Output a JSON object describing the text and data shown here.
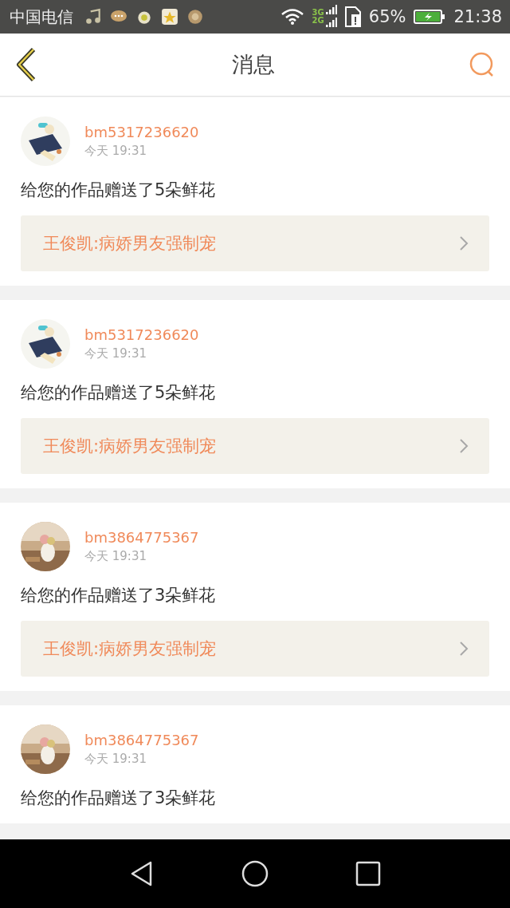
{
  "status_bar": {
    "carrier": "中国电信",
    "network_labels": [
      "3G",
      "2G"
    ],
    "battery_percent": "65%",
    "time": "21:38"
  },
  "header": {
    "title": "消息"
  },
  "messages": [
    {
      "username": "bm5317236620",
      "time": "今天 19:31",
      "text": "给您的作品赠送了5朵鲜花",
      "work_title": "王俊凯:病娇男友强制宠"
    },
    {
      "username": "bm5317236620",
      "time": "今天 19:31",
      "text": "给您的作品赠送了5朵鲜花",
      "work_title": "王俊凯:病娇男友强制宠"
    },
    {
      "username": "bm3864775367",
      "time": "今天 19:31",
      "text": "给您的作品赠送了3朵鲜花",
      "work_title": "王俊凯:病娇男友强制宠"
    },
    {
      "username": "bm3864775367",
      "time": "今天 19:31",
      "text": "给您的作品赠送了3朵鲜花"
    }
  ]
}
